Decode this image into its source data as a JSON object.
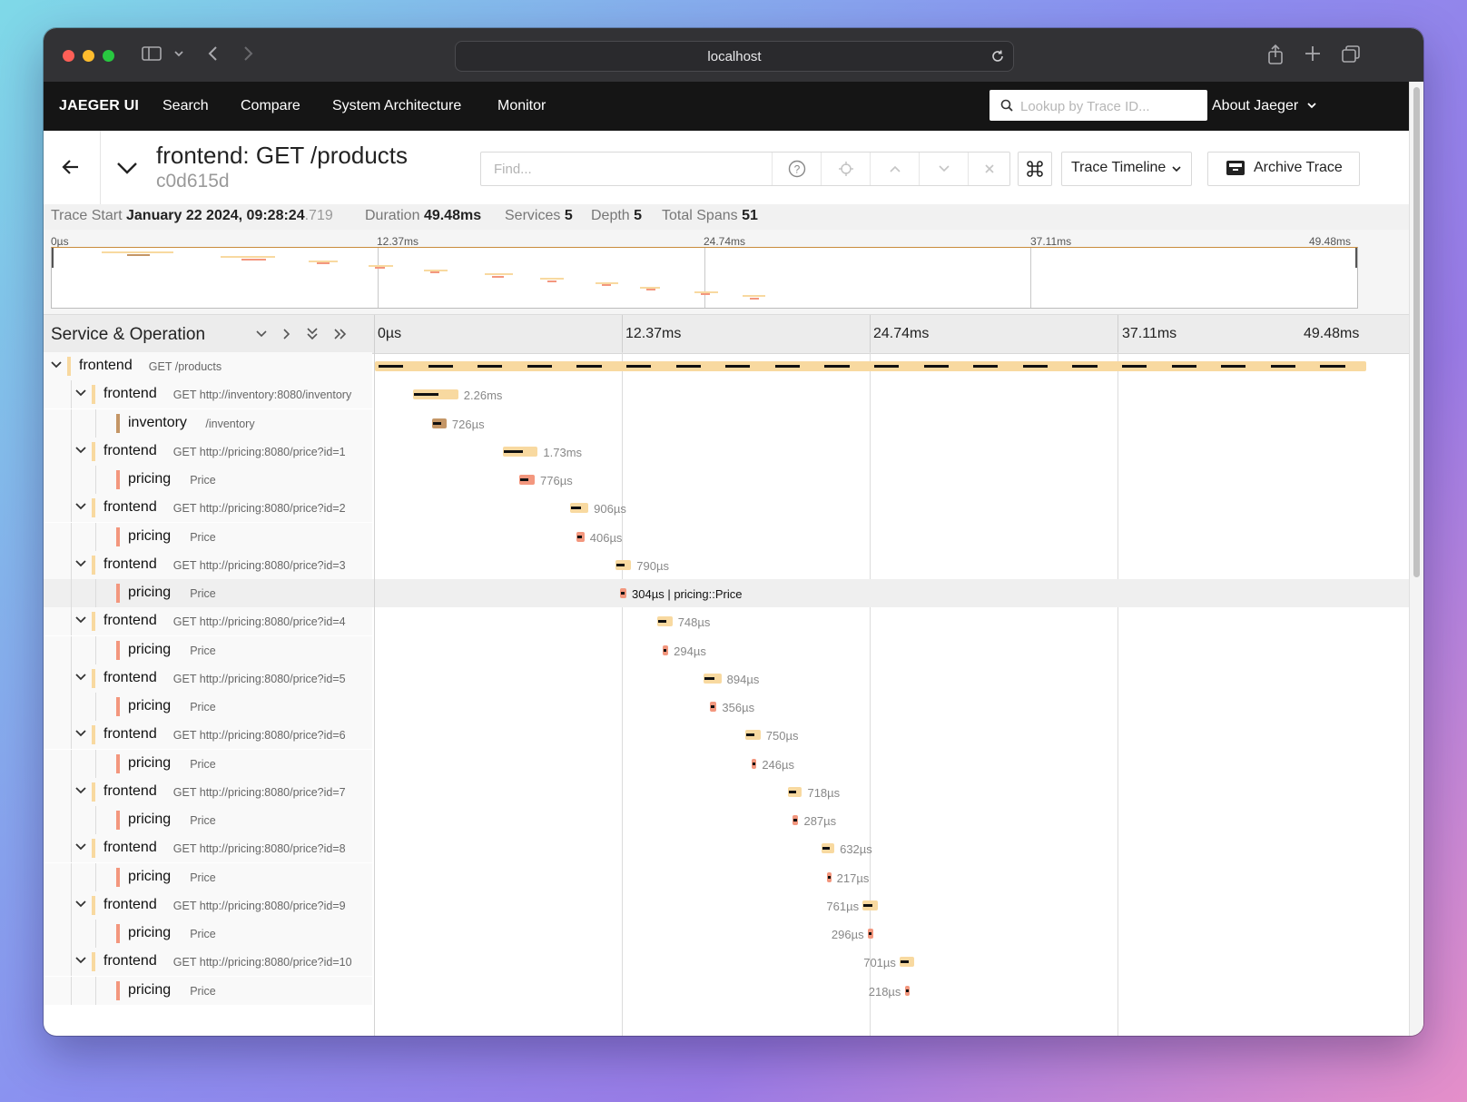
{
  "browser": {
    "url": "localhost"
  },
  "nav": {
    "brand": "JAEGER UI",
    "items": [
      "Search",
      "Compare",
      "System Architecture",
      "Monitor"
    ],
    "lookup_placeholder": "Lookup by Trace ID...",
    "about": "About Jaeger"
  },
  "trace": {
    "title": "frontend: GET /products",
    "id": "c0d615d",
    "find_placeholder": "Find...",
    "view_label": "Trace Timeline",
    "archive_label": "Archive Trace"
  },
  "summary": {
    "start_label": "Trace Start",
    "start_value": "January 22 2024, 09:28:24",
    "start_ms": ".719",
    "duration_label": "Duration",
    "duration_value": "49.48ms",
    "services_label": "Services",
    "services_value": "5",
    "depth_label": "Depth",
    "depth_value": "5",
    "spans_label": "Total Spans",
    "spans_value": "51"
  },
  "ticks": [
    "0µs",
    "12.37ms",
    "24.74ms",
    "37.11ms",
    "49.48ms"
  ],
  "columns": {
    "service_operation": "Service & Operation"
  },
  "colors": {
    "frontend": "#f8d9a0",
    "inventory": "#c49666",
    "pricing": "#f3977e",
    "highlight_text": "#111111"
  },
  "spans": [
    {
      "service": "frontend",
      "op": "GET /products",
      "depth": 0,
      "toggle": true,
      "start_ms": 0,
      "dur_ms": 49.48,
      "dur": "",
      "color": "frontend"
    },
    {
      "service": "frontend",
      "op": "GET http://inventory:8080/inventory",
      "depth": 1,
      "toggle": true,
      "start_ms": 1.9,
      "dur_ms": 2.26,
      "dur": "2.26ms",
      "color": "frontend"
    },
    {
      "service": "inventory",
      "op": "/inventory",
      "depth": 2,
      "toggle": false,
      "start_ms": 2.85,
      "dur_ms": 0.726,
      "dur": "726µs",
      "color": "inventory"
    },
    {
      "service": "frontend",
      "op": "GET http://pricing:8080/price?id=1",
      "depth": 1,
      "toggle": true,
      "start_ms": 6.4,
      "dur_ms": 1.73,
      "dur": "1.73ms",
      "color": "frontend"
    },
    {
      "service": "pricing",
      "op": "Price",
      "depth": 2,
      "toggle": false,
      "start_ms": 7.2,
      "dur_ms": 0.776,
      "dur": "776µs",
      "color": "pricing"
    },
    {
      "service": "frontend",
      "op": "GET http://pricing:8080/price?id=2",
      "depth": 1,
      "toggle": true,
      "start_ms": 9.75,
      "dur_ms": 0.906,
      "dur": "906µs",
      "color": "frontend"
    },
    {
      "service": "pricing",
      "op": "Price",
      "depth": 2,
      "toggle": false,
      "start_ms": 10.05,
      "dur_ms": 0.406,
      "dur": "406µs",
      "color": "pricing"
    },
    {
      "service": "frontend",
      "op": "GET http://pricing:8080/price?id=3",
      "depth": 1,
      "toggle": true,
      "start_ms": 12.0,
      "dur_ms": 0.79,
      "dur": "790µs",
      "color": "frontend"
    },
    {
      "service": "pricing",
      "op": "Price",
      "depth": 2,
      "toggle": false,
      "start_ms": 12.25,
      "dur_ms": 0.304,
      "dur": "304µs | pricing::Price",
      "color": "pricing",
      "highlight": true
    },
    {
      "service": "frontend",
      "op": "GET http://pricing:8080/price?id=4",
      "depth": 1,
      "toggle": true,
      "start_ms": 14.1,
      "dur_ms": 0.748,
      "dur": "748µs",
      "color": "frontend"
    },
    {
      "service": "pricing",
      "op": "Price",
      "depth": 2,
      "toggle": false,
      "start_ms": 14.35,
      "dur_ms": 0.294,
      "dur": "294µs",
      "color": "pricing"
    },
    {
      "service": "frontend",
      "op": "GET http://pricing:8080/price?id=5",
      "depth": 1,
      "toggle": true,
      "start_ms": 16.4,
      "dur_ms": 0.894,
      "dur": "894µs",
      "color": "frontend"
    },
    {
      "service": "pricing",
      "op": "Price",
      "depth": 2,
      "toggle": false,
      "start_ms": 16.7,
      "dur_ms": 0.356,
      "dur": "356µs",
      "color": "pricing"
    },
    {
      "service": "frontend",
      "op": "GET http://pricing:8080/price?id=6",
      "depth": 1,
      "toggle": true,
      "start_ms": 18.5,
      "dur_ms": 0.75,
      "dur": "750µs",
      "color": "frontend"
    },
    {
      "service": "pricing",
      "op": "Price",
      "depth": 2,
      "toggle": false,
      "start_ms": 18.8,
      "dur_ms": 0.246,
      "dur": "246µs",
      "color": "pricing"
    },
    {
      "service": "frontend",
      "op": "GET http://pricing:8080/price?id=7",
      "depth": 1,
      "toggle": true,
      "start_ms": 20.6,
      "dur_ms": 0.718,
      "dur": "718µs",
      "color": "frontend"
    },
    {
      "service": "pricing",
      "op": "Price",
      "depth": 2,
      "toggle": false,
      "start_ms": 20.85,
      "dur_ms": 0.287,
      "dur": "287µs",
      "color": "pricing"
    },
    {
      "service": "frontend",
      "op": "GET http://pricing:8080/price?id=8",
      "depth": 1,
      "toggle": true,
      "start_ms": 22.3,
      "dur_ms": 0.632,
      "dur": "632µs",
      "color": "frontend"
    },
    {
      "service": "pricing",
      "op": "Price",
      "depth": 2,
      "toggle": false,
      "start_ms": 22.55,
      "dur_ms": 0.217,
      "dur": "217µs",
      "color": "pricing"
    },
    {
      "service": "frontend",
      "op": "GET http://pricing:8080/price?id=9",
      "depth": 1,
      "toggle": true,
      "start_ms": 24.35,
      "dur_ms": 0.761,
      "dur": "761µs",
      "color": "frontend"
    },
    {
      "service": "pricing",
      "op": "Price",
      "depth": 2,
      "toggle": false,
      "start_ms": 24.6,
      "dur_ms": 0.296,
      "dur": "296µs",
      "color": "pricing"
    },
    {
      "service": "frontend",
      "op": "GET http://pricing:8080/price?id=10",
      "depth": 1,
      "toggle": true,
      "start_ms": 26.2,
      "dur_ms": 0.701,
      "dur": "701µs",
      "color": "frontend"
    },
    {
      "service": "pricing",
      "op": "Price",
      "depth": 2,
      "toggle": false,
      "start_ms": 26.45,
      "dur_ms": 0.218,
      "dur": "218µs",
      "color": "pricing"
    }
  ]
}
